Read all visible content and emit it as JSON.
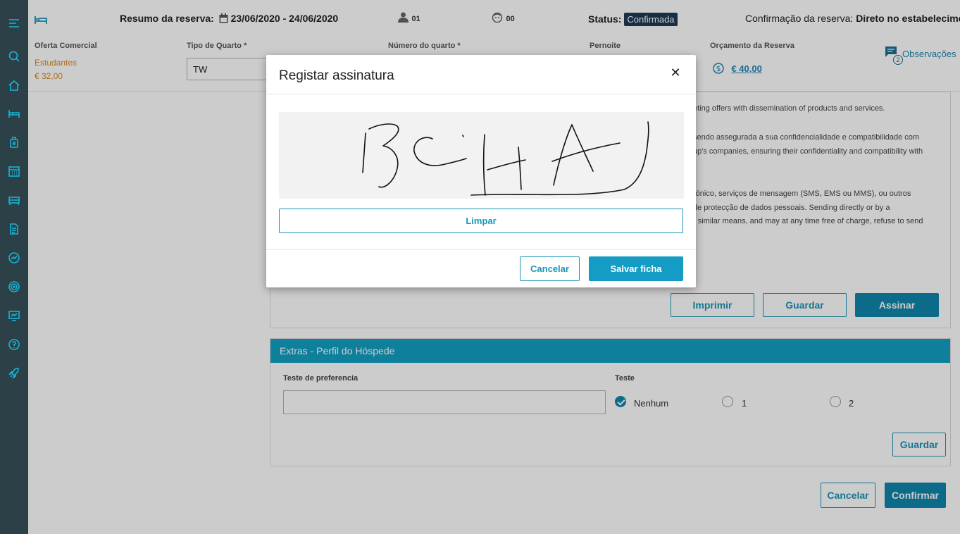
{
  "header": {
    "summary_label": "Resumo da reserva:",
    "dates": "23/06/2020 - 24/06/2020",
    "adults": "01",
    "children": "00",
    "status_label": "Status:",
    "status_value": "Confirmada",
    "confirmation_label": "Confirmação da reserva:",
    "confirmation_value": "Direto no estabelecimento",
    "fields": {
      "oferta_label": "Oferta Comercial",
      "oferta_value": "Estudantes",
      "oferta_price": "€ 32,00",
      "tipo_quarto_label": "Tipo de Quarto *",
      "tipo_quarto_value": "TW",
      "numero_quarto_label": "Número do quarto *",
      "pernoite_label": "Pernoite",
      "orcamento_label": "Orçamento da Reserva",
      "orcamento_value": "€ 40,00",
      "observacoes_label": "Observações",
      "observacoes_count": "2"
    }
  },
  "consent": {
    "lines": [
      "eting offers with dissemination of products and services.",
      "sendo assegurada a sua confidencialidade e compatibilidade com",
      "up's companies, ensuring their confidentiality and compatibility with",
      "rónico, serviços de mensagem (SMS, EMS ou MMS), ou outros",
      "de protecção de dados pessoais. Sending directly or by a",
      "r similar means, and may at any time free of charge, refuse to send"
    ],
    "print_label": "Imprimir",
    "save_label": "Guardar",
    "sign_label": "Assinar"
  },
  "extras": {
    "title": "Extras - Perfil do Hóspede",
    "preference_label": "Teste de preferencia",
    "test_label": "Teste",
    "options": [
      "Nenhum",
      "1",
      "2"
    ],
    "save_label": "Guardar"
  },
  "footer": {
    "cancel_label": "Cancelar",
    "confirm_label": "Confirmar"
  },
  "modal": {
    "title": "Registar assinatura",
    "close_glyph": "✕",
    "clear_label": "Limpar",
    "cancel_label": "Cancelar",
    "save_label": "Salvar ficha"
  },
  "colors": {
    "sidebar": "#2c4147",
    "accent": "#0f86aa",
    "icon": "#16b4d8",
    "status_badge": "#1c3b57",
    "offer_text": "#d88a27"
  },
  "sidebar_icons": [
    "menu-icon",
    "search-icon",
    "home-icon",
    "bed-icon",
    "luggage-icon",
    "calendar-icon",
    "room-icon",
    "document-icon",
    "chart-icon",
    "target-icon",
    "report-icon",
    "help-icon",
    "rocket-icon"
  ]
}
